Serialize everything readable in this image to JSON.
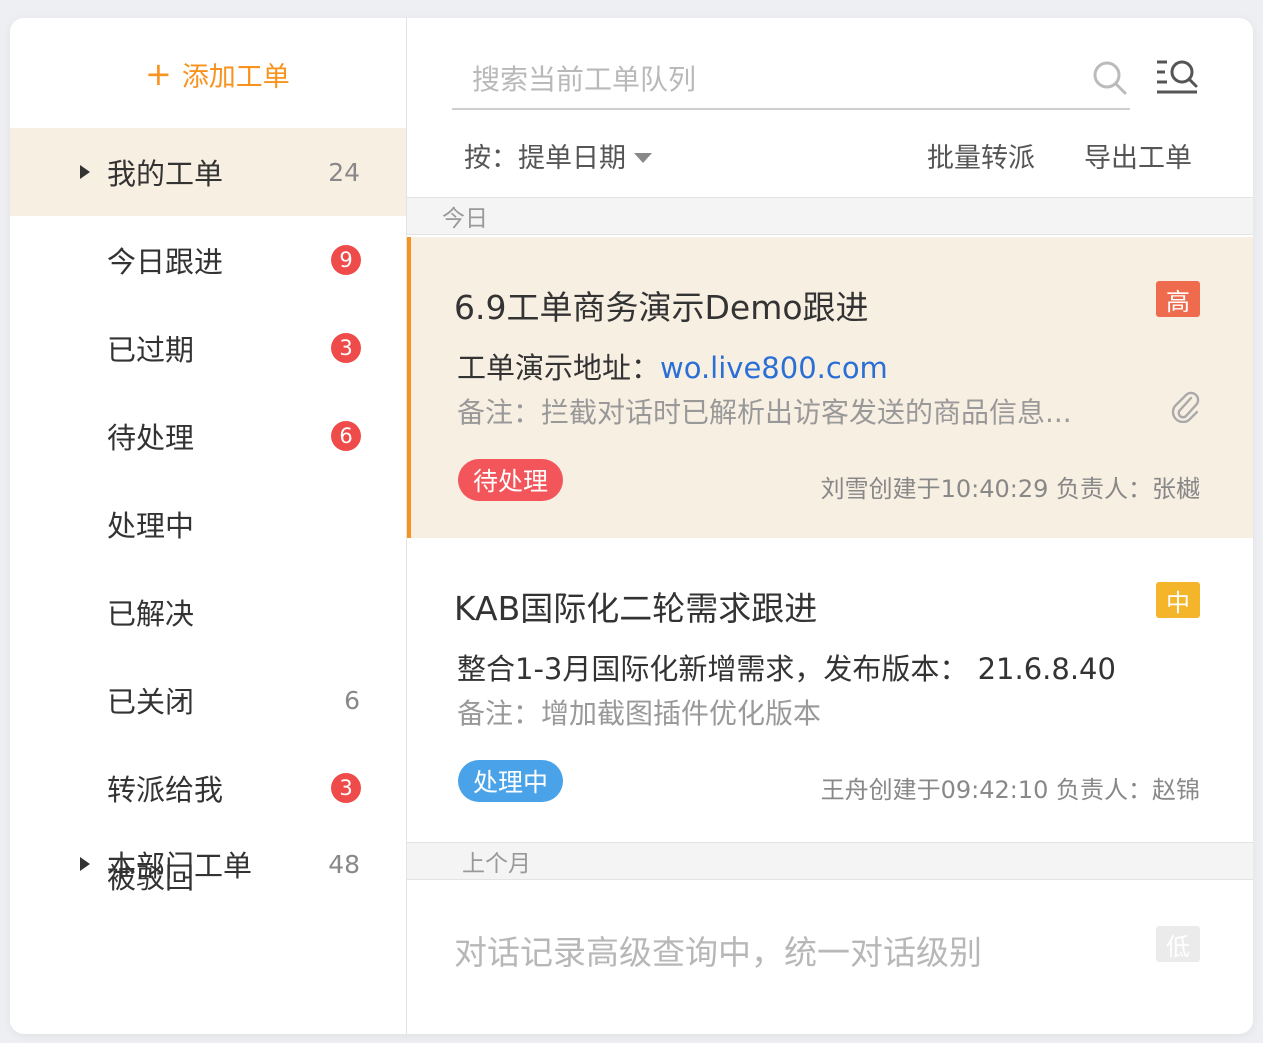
{
  "sidebar": {
    "add_label": "添加工单",
    "items": [
      {
        "label": "我的工单",
        "count": "24",
        "badge": null
      },
      {
        "label": "今日跟进",
        "count": null,
        "badge": "9"
      },
      {
        "label": "已过期",
        "count": null,
        "badge": "3"
      },
      {
        "label": "待处理",
        "count": null,
        "badge": "6"
      },
      {
        "label": "处理中",
        "count": null,
        "badge": null
      },
      {
        "label": "已解决",
        "count": null,
        "badge": null
      },
      {
        "label": "已关闭",
        "count": "6",
        "badge": null
      },
      {
        "label": "转派给我",
        "count": null,
        "badge": "3"
      },
      {
        "label": "被驳回",
        "count": null,
        "badge": null
      }
    ],
    "dept": {
      "label": "本部门工单",
      "count": "48"
    }
  },
  "search": {
    "placeholder": "搜索当前工单队列"
  },
  "toolbar": {
    "sort_label": "按：提单日期",
    "batch_label": "批量转派",
    "export_label": "导出工单"
  },
  "groups": {
    "today": "今日",
    "last_month": "上个月"
  },
  "tickets": [
    {
      "title": "6.9工单商务演示Demo跟进",
      "line_prefix": "工单演示地址：",
      "line_link": "wo.live800.com",
      "note": "备注：拦截对话时已解析出访客发送的商品信息...",
      "priority": "高",
      "priority_color": "#ee6b4d",
      "status": "待处理",
      "status_color": "#f2555a",
      "meta": "刘雪创建于10:40:29   负责人：张樾"
    },
    {
      "title": "KAB国际化二轮需求跟进",
      "line_text": "整合1-3月国际化新增需求，发布版本： 21.6.8.40",
      "note": "备注：增加截图插件优化版本",
      "priority": "中",
      "priority_color": "#f5b52a",
      "status": "处理中",
      "status_color": "#4aa3e8",
      "meta": "王舟创建于09:42:10   负责人：赵锦"
    },
    {
      "title": "对话记录高级查询中，统一对话级别",
      "priority": "低",
      "priority_color": "#c8c8c8"
    }
  ],
  "colors": {
    "accent": "#f7931e",
    "active_bg": "#f8efe3",
    "link": "#2a6fd6"
  }
}
